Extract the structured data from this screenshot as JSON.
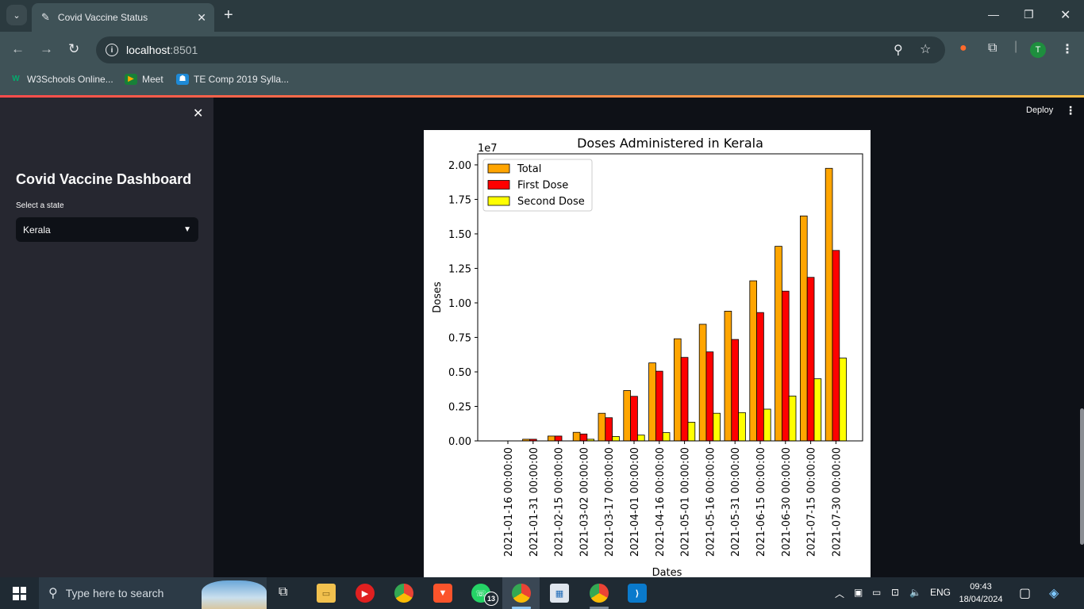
{
  "browser": {
    "tab_title": "Covid Vaccine Status",
    "url_host": "localhost",
    "url_port": ":8501",
    "bookmarks": [
      {
        "label": "W3Schools Online...",
        "icon": "w3schools-icon",
        "color": "#04aa6d",
        "glyph": "W"
      },
      {
        "label": "Meet",
        "icon": "meet-icon",
        "color": "#f9ab00",
        "glyph": "▶"
      },
      {
        "label": "TE Comp 2019 Sylla...",
        "icon": "classroom-icon",
        "color": "#1e8ad6",
        "glyph": "☗"
      }
    ],
    "avatar_letter": "T"
  },
  "app": {
    "deploy_label": "Deploy",
    "sidebar": {
      "title": "Covid Vaccine Dashboard",
      "select_label": "Select a state",
      "select_value": "Kerala"
    }
  },
  "chart_data": {
    "type": "bar",
    "title": "Doses Administered in Kerala",
    "xlabel": "Dates",
    "ylabel": "Doses",
    "offset_label": "1e7",
    "legend_position": "upper-left",
    "ylim": [
      0,
      2.08
    ],
    "yticks": [
      "0.00",
      "0.25",
      "0.50",
      "0.75",
      "1.00",
      "1.25",
      "1.50",
      "1.75",
      "2.00"
    ],
    "categories": [
      "2021-01-16 00:00:00",
      "2021-01-31 00:00:00",
      "2021-02-15 00:00:00",
      "2021-03-02 00:00:00",
      "2021-03-17 00:00:00",
      "2021-04-01 00:00:00",
      "2021-04-16 00:00:00",
      "2021-05-01 00:00:00",
      "2021-05-16 00:00:00",
      "2021-05-31 00:00:00",
      "2021-06-15 00:00:00",
      "2021-06-30 00:00:00",
      "2021-07-15 00:00:00",
      "2021-07-30 00:00:00"
    ],
    "series": [
      {
        "name": "Total",
        "color": "#ffa500",
        "values": [
          0.0,
          0.012,
          0.035,
          0.062,
          0.2,
          0.365,
          0.565,
          0.74,
          0.845,
          0.94,
          1.16,
          1.41,
          1.63,
          1.975
        ]
      },
      {
        "name": "First Dose",
        "color": "#ff0000",
        "values": [
          0.0,
          0.012,
          0.035,
          0.05,
          0.168,
          0.323,
          0.505,
          0.605,
          0.645,
          0.735,
          0.93,
          1.085,
          1.185,
          1.38
        ]
      },
      {
        "name": "Second Dose",
        "color": "#ffff00",
        "values": [
          0.0,
          0.0,
          0.0,
          0.012,
          0.032,
          0.042,
          0.06,
          0.135,
          0.2,
          0.205,
          0.23,
          0.325,
          0.45,
          0.6
        ]
      }
    ]
  },
  "taskbar": {
    "search_placeholder": "Type here to search",
    "whatsapp_badge": "13",
    "lang": "ENG",
    "time": "09:43",
    "date": "18/04/2024"
  }
}
